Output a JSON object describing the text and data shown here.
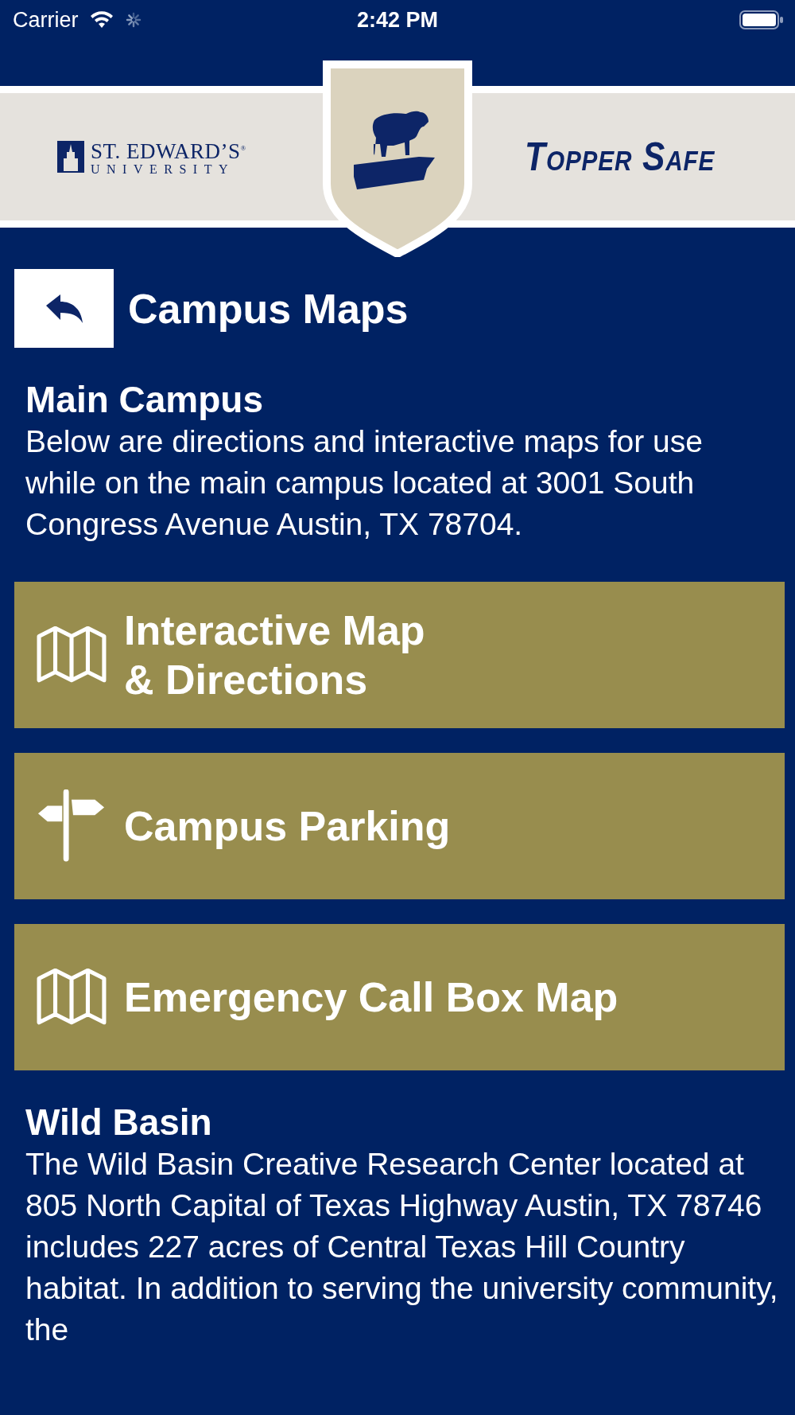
{
  "status_bar": {
    "carrier": "Carrier",
    "time": "2:42 PM"
  },
  "header": {
    "university_logo": {
      "line_1": "ST. EDWARD’S$^{®}$",
      "line_2": "UNIVERSITY"
    },
    "app_name": "Topper Safe"
  },
  "page": {
    "title": "Campus Maps"
  },
  "sections": [
    {
      "heading": "Main Campus",
      "body": "Below are directions and interactive maps for use while on the main campus located at 3001 South Congress Avenue Austin, TX 78704.",
      "buttons": [
        {
          "label": "Interactive Map\n& Directions",
          "kind": "map"
        },
        {
          "label": "Campus Parking",
          "kind": "signpost"
        },
        {
          "label": "Emergency Call Box Map",
          "kind": "map"
        }
      ]
    },
    {
      "heading": "Wild Basin",
      "body": "The Wild Basin Creative Research Center located at 805 North Capital of Texas Highway Austin, TX 78746 includes 227 acres of Central Texas Hill Country habitat. In addition to serving the university community, the"
    }
  ]
}
